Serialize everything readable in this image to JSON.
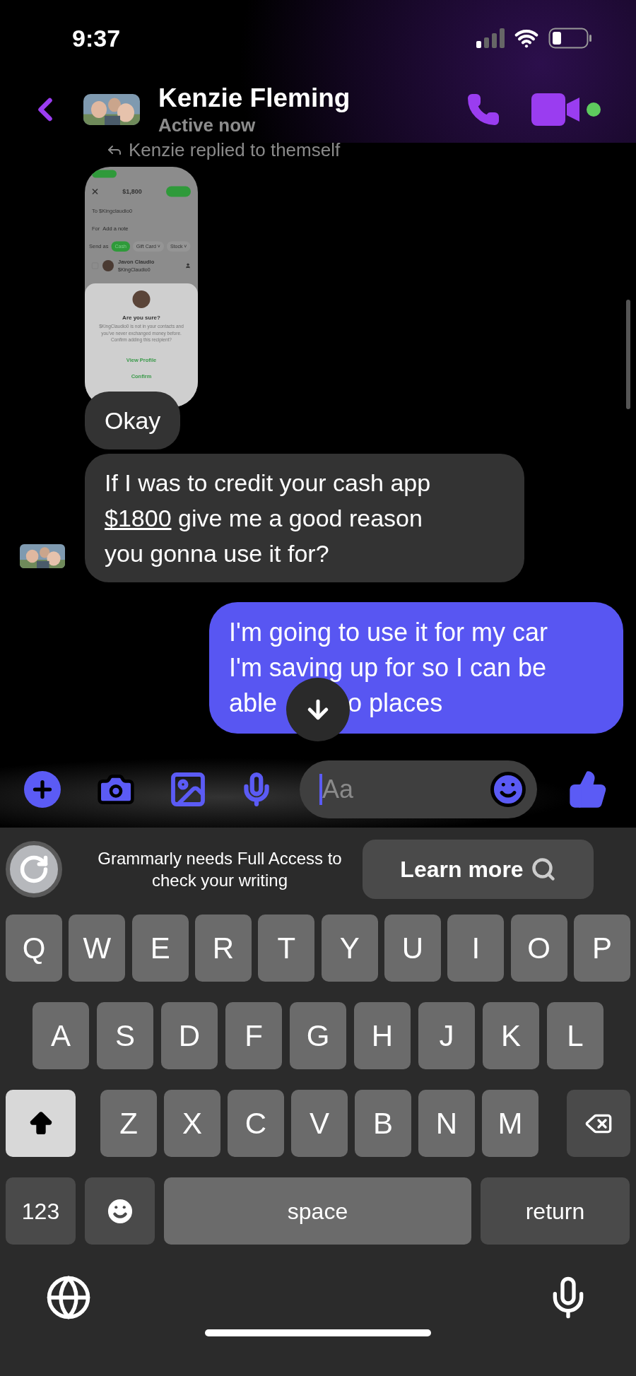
{
  "status_bar": {
    "time": "9:37"
  },
  "header": {
    "name": "Kenzie Fleming",
    "status": "Active now",
    "online": true
  },
  "reply_note": "Kenzie replied to themself",
  "shared_screenshot": {
    "amount": "$1,800",
    "to": "To $Kingclaudio0",
    "for_label": "For",
    "for_placeholder": "Add a note",
    "send_as": "Send as",
    "options": [
      {
        "label": "Cash",
        "selected": true
      },
      {
        "label": "Gift Card ˅",
        "selected": false
      },
      {
        "label": "Stock ˅",
        "selected": false
      }
    ],
    "contact_checked": false,
    "contact_name": "Javon Claudio",
    "contact_handle": "$KingClaudio0",
    "dialog_title": "Are you sure?",
    "dialog_text": "$KingClaudio0 is not in your contacts and you've never exchanged money before. Confirm adding this recipient?",
    "actions": [
      "View Profile",
      "Confirm"
    ]
  },
  "messages": [
    {
      "kind": "incoming",
      "text": "Okay"
    },
    {
      "kind": "incoming",
      "before": "If I was to credit your cash app ",
      "link": "$1800",
      "after": " give me a good reason you gonna use it for?"
    },
    {
      "kind": "outgoing",
      "lines": [
        [
          "I'm going to use it for my car"
        ],
        [
          "I'm saving up for so I can be"
        ],
        [
          "able",
          "o places"
        ]
      ]
    }
  ],
  "composer": {
    "placeholder": "Aa"
  },
  "grammarly": {
    "message": "Grammarly needs Full Access to check your writing",
    "button": "Learn more"
  },
  "keyboard": {
    "rows": [
      [
        "Q",
        "W",
        "E",
        "R",
        "T",
        "Y",
        "U",
        "I",
        "O",
        "P"
      ],
      [
        "A",
        "S",
        "D",
        "F",
        "G",
        "H",
        "J",
        "K",
        "L"
      ],
      [
        "Z",
        "X",
        "C",
        "V",
        "B",
        "N",
        "M"
      ]
    ],
    "shift": {
      "on": true
    },
    "numbers": "123",
    "space": "space",
    "return": "return"
  }
}
